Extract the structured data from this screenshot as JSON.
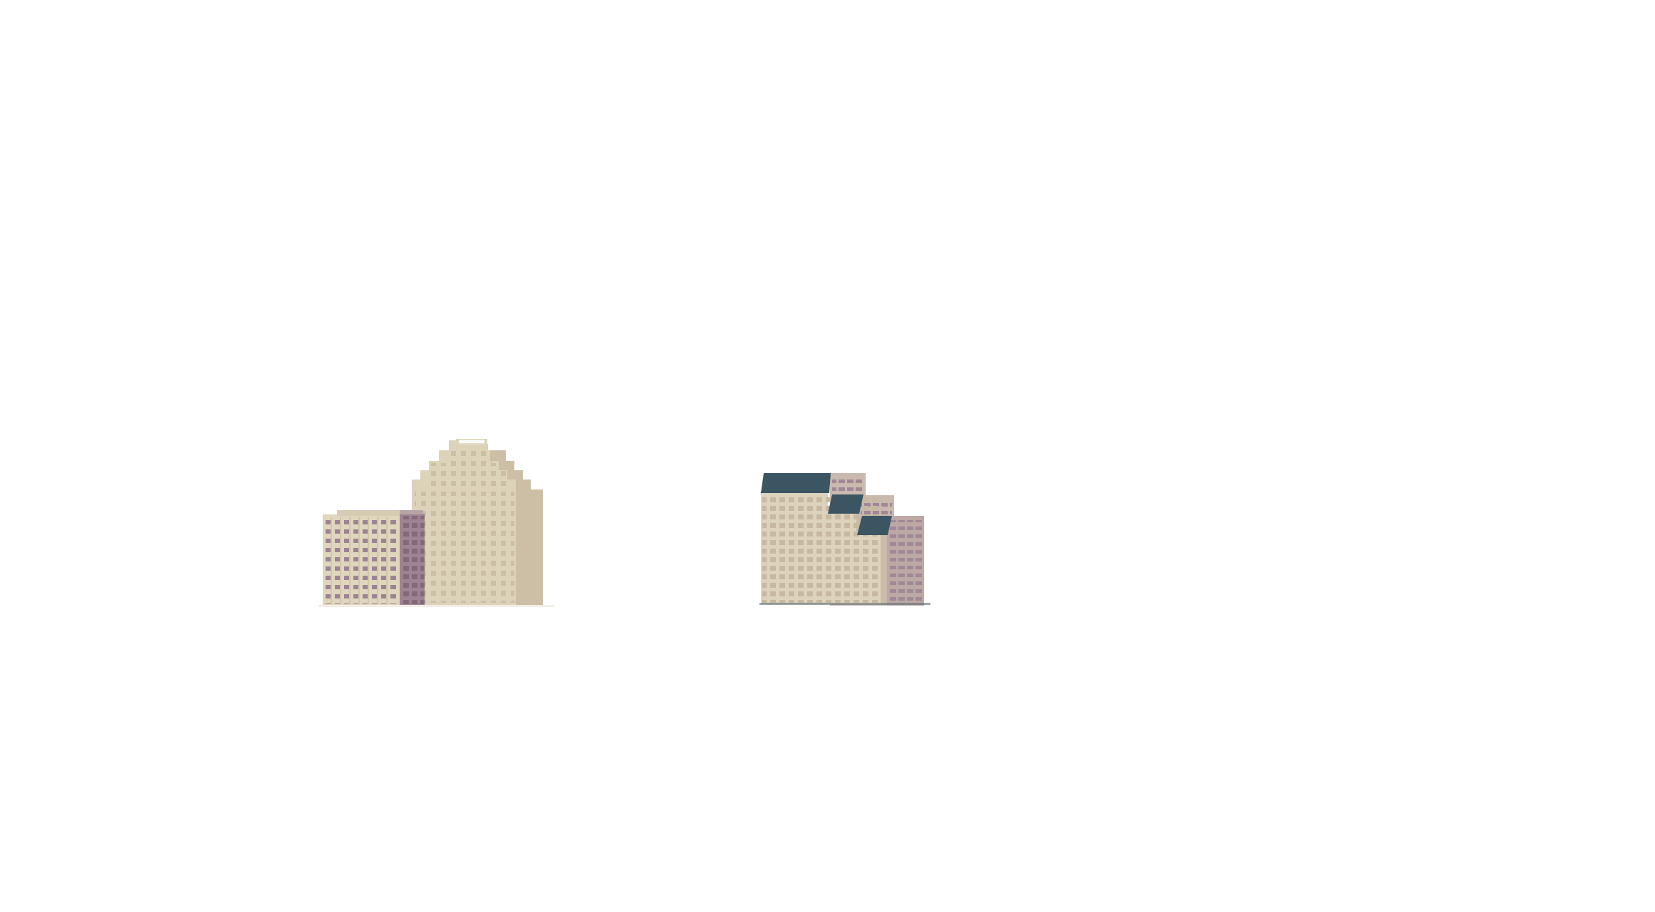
{
  "scene": {
    "background": "#ffffff",
    "illustrations": [
      {
        "icon": "office-buildings-cluster-left-icon"
      },
      {
        "icon": "office-buildings-cluster-right-icon"
      }
    ]
  },
  "colors": {
    "facade_light": "#ddd3b9",
    "facade_main": "#d6cbb3",
    "facade_shadow": "#c7b9a1",
    "window_light": "#c7b9a1",
    "mauve_facade": "#9e8392",
    "mauve_window": "#85697a",
    "roof_dark": "#3b5563",
    "window_on_mauve": "#b7a5a4"
  }
}
